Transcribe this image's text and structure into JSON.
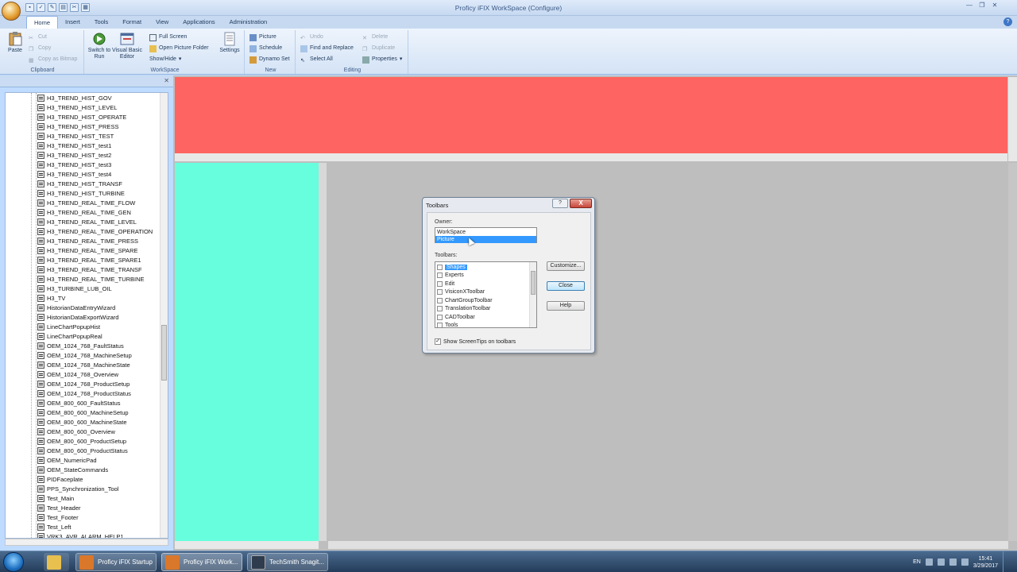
{
  "window": {
    "title": "Proficy iFIX WorkSpace (Configure)"
  },
  "tabs": [
    "Home",
    "Insert",
    "Tools",
    "Format",
    "View",
    "Applications",
    "Administration"
  ],
  "ribbon": {
    "clipboard": {
      "paste": "Paste",
      "cut": "Cut",
      "copy": "Copy",
      "copy_bitmap": "Copy as Bitmap",
      "label": "Clipboard"
    },
    "workspace": {
      "switch_run": "Switch to Run",
      "vba": "Visual Basic Editor",
      "full_screen": "Full Screen",
      "open_folder": "Open Picture Folder",
      "show_hide": "Show/Hide",
      "settings": "Settings",
      "label": "WorkSpace"
    },
    "new": {
      "picture": "Picture",
      "schedule": "Schedule",
      "dynamo_set": "Dynamo Set",
      "label": "New"
    },
    "editing": {
      "undo": "Undo",
      "delete": "Delete",
      "find_replace": "Find and Replace",
      "duplicate": "Duplicate",
      "select_all": "Select All",
      "properties": "Properties",
      "label": "Editing"
    }
  },
  "tree": {
    "items": [
      "H3_TREND_HIST_GOV",
      "H3_TREND_HIST_LEVEL",
      "H3_TREND_HIST_OPERATE",
      "H3_TREND_HIST_PRESS",
      "H3_TREND_HIST_TEST",
      "H3_TREND_HIST_test1",
      "H3_TREND_HIST_test2",
      "H3_TREND_HIST_test3",
      "H3_TREND_HIST_test4",
      "H3_TREND_HIST_TRANSF",
      "H3_TREND_HIST_TURBINE",
      "H3_TREND_REAL_TIME_FLOW",
      "H3_TREND_REAL_TIME_GEN",
      "H3_TREND_REAL_TIME_LEVEL",
      "H3_TREND_REAL_TIME_OPERATION",
      "H3_TREND_REAL_TIME_PRESS",
      "H3_TREND_REAL_TIME_SPARE",
      "H3_TREND_REAL_TIME_SPARE1",
      "H3_TREND_REAL_TIME_TRANSF",
      "H3_TREND_REAL_TIME_TURBINE",
      "H3_TURBINE_LUB_OIL",
      "H3_TV",
      "HistorianDataEntryWizard",
      "HistorianDataExportWizard",
      "LineChartPopupHist",
      "LineChartPopupReal",
      "OEM_1024_768_FaultStatus",
      "OEM_1024_768_MachineSetup",
      "OEM_1024_768_MachineState",
      "OEM_1024_768_Overview",
      "OEM_1024_768_ProductSetup",
      "OEM_1024_768_ProductStatus",
      "OEM_800_600_FaultStatus",
      "OEM_800_600_MachineSetup",
      "OEM_800_600_MachineState",
      "OEM_800_600_Overview",
      "OEM_800_600_ProductSetup",
      "OEM_800_600_ProductStatus",
      "OEM_NumericPad",
      "OEM_StateCommands",
      "PIDFaceplate",
      "PPS_Synchronization_Tool",
      "Test_Main",
      "Test_Header",
      "Test_Footer",
      "Test_Left",
      "VRK3_AVR_ALARM_HELP1"
    ]
  },
  "dialog": {
    "title": "Toolbars",
    "help_btn": "?",
    "close_btn": "X",
    "owner_label": "Owner:",
    "owners": [
      "WorkSpace",
      "Picture"
    ],
    "toolbars_label": "Toolbars:",
    "toolbars": [
      "Shapes",
      "Experts",
      "Edit",
      "VisiconXToolbar",
      "ChartGroupToolbar",
      "TranslationToolbar",
      "CADToolbar",
      "Tools"
    ],
    "customize": "Customize...",
    "close": "Close",
    "help": "Help",
    "screentips": "Show ScreenTips on toolbars"
  },
  "taskbar": {
    "apps": [
      "Proficy iFIX Startup",
      "Proficy iFIX Work...",
      "TechSmith Snagit..."
    ],
    "lang": "EN",
    "time": "15:41",
    "date": "3/29/2017"
  }
}
